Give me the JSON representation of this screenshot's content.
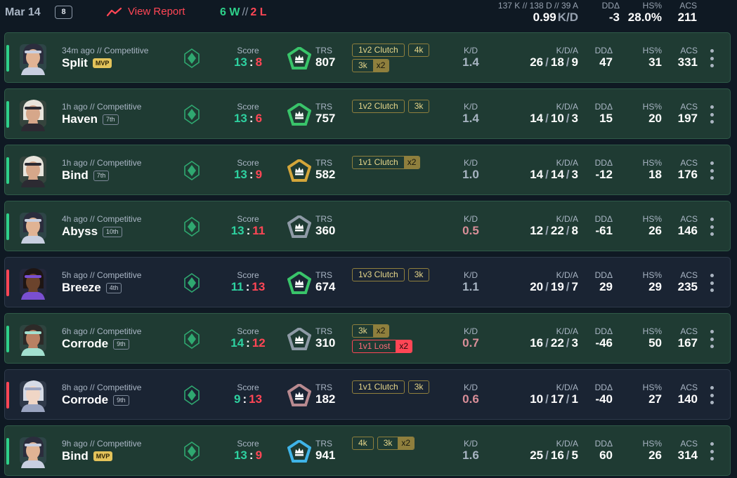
{
  "header": {
    "date": "Mar 14",
    "match_count": "8",
    "view_report_label": "View Report",
    "wins": "6 W",
    "separator": "//",
    "losses": "2 L",
    "kda_raw": "137 K // 138 D // 39 A",
    "kd_value": "0.99",
    "kd_unit": "K/D",
    "stats": [
      {
        "label": "DDΔ",
        "value": "-3"
      },
      {
        "label": "HS%",
        "value": "28.0%"
      },
      {
        "label": "ACS",
        "value": "211"
      }
    ]
  },
  "column_labels": {
    "score": "Score",
    "trs": "TRS",
    "kd": "K/D",
    "kda": "K/D/A",
    "dd": "DDΔ",
    "hs": "HS%",
    "acs": "ACS"
  },
  "matches": [
    {
      "result": "win",
      "agent": "agent-portrait-white-hair",
      "meta": "34m ago // Competitive",
      "map": "Split",
      "badge": {
        "type": "mvp",
        "text": "MVP"
      },
      "rank_color": "#2fa870",
      "score_own": "13",
      "score_opp": "8",
      "trs_color": "#39c46a",
      "trs": "807",
      "tags": [
        [
          {
            "label": "1v2 Clutch"
          },
          {
            "label": "4k"
          }
        ],
        [
          {
            "label": "3k",
            "mult": "x2"
          }
        ]
      ],
      "kd": "1.4",
      "kd_bad": false,
      "kills": "26",
      "deaths": "18",
      "assists": "9",
      "dd": "47",
      "hs": "31",
      "acs": "331"
    },
    {
      "result": "win",
      "agent": "agent-portrait-cowboy-hat",
      "meta": "1h ago // Competitive",
      "map": "Haven",
      "badge": {
        "type": "place",
        "text": "7th"
      },
      "rank_color": "#2fa870",
      "score_own": "13",
      "score_opp": "6",
      "trs_color": "#39c46a",
      "trs": "757",
      "tags": [
        [
          {
            "label": "1v2 Clutch"
          },
          {
            "label": "3k"
          }
        ]
      ],
      "kd": "1.4",
      "kd_bad": false,
      "kills": "14",
      "deaths": "10",
      "assists": "3",
      "dd": "15",
      "hs": "20",
      "acs": "197"
    },
    {
      "result": "win",
      "agent": "agent-portrait-cowboy-hat",
      "meta": "1h ago // Competitive",
      "map": "Bind",
      "badge": {
        "type": "place",
        "text": "7th"
      },
      "rank_color": "#2fa870",
      "score_own": "13",
      "score_opp": "9",
      "trs_color": "#d4a63a",
      "trs": "582",
      "tags": [
        [
          {
            "label": "1v1 Clutch",
            "mult": "x2"
          }
        ]
      ],
      "kd": "1.0",
      "kd_bad": false,
      "kills": "14",
      "deaths": "14",
      "assists": "3",
      "dd": "-12",
      "hs": "18",
      "acs": "176"
    },
    {
      "result": "win",
      "agent": "agent-portrait-white-hair",
      "meta": "4h ago // Competitive",
      "map": "Abyss",
      "badge": {
        "type": "place",
        "text": "10th"
      },
      "rank_color": "#2fa870",
      "score_own": "13",
      "score_opp": "11",
      "trs_color": "#8e9aa6",
      "trs": "360",
      "tags": [],
      "kd": "0.5",
      "kd_bad": true,
      "kills": "12",
      "deaths": "22",
      "assists": "8",
      "dd": "-61",
      "hs": "26",
      "acs": "146"
    },
    {
      "result": "loss",
      "agent": "agent-portrait-dark-skin",
      "meta": "5h ago // Competitive",
      "map": "Breeze",
      "badge": {
        "type": "place",
        "text": "4th"
      },
      "rank_color": "#2fa870",
      "score_own": "11",
      "score_opp": "13",
      "trs_color": "#39c46a",
      "trs": "674",
      "tags": [
        [
          {
            "label": "1v3 Clutch"
          },
          {
            "label": "3k"
          }
        ]
      ],
      "kd": "1.1",
      "kd_bad": false,
      "kills": "20",
      "deaths": "19",
      "assists": "7",
      "dd": "29",
      "hs": "29",
      "acs": "235"
    },
    {
      "result": "win",
      "agent": "agent-portrait-tan-skin",
      "meta": "6h ago // Competitive",
      "map": "Corrode",
      "badge": {
        "type": "place",
        "text": "9th"
      },
      "rank_color": "#2fa870",
      "score_own": "14",
      "score_opp": "12",
      "trs_color": "#8e9aa6",
      "trs": "310",
      "tags": [
        [
          {
            "label": "3k",
            "mult": "x2"
          }
        ],
        [
          {
            "label": "1v1 Lost",
            "mult": "x2",
            "lost": true
          }
        ]
      ],
      "kd": "0.7",
      "kd_bad": true,
      "kills": "16",
      "deaths": "22",
      "assists": "3",
      "dd": "-46",
      "hs": "50",
      "acs": "167"
    },
    {
      "result": "loss",
      "agent": "agent-portrait-silver-hair",
      "meta": "8h ago // Competitive",
      "map": "Corrode",
      "badge": {
        "type": "place",
        "text": "9th"
      },
      "rank_color": "#2fa870",
      "score_own": "9",
      "score_opp": "13",
      "trs_color": "#b88a90",
      "trs": "182",
      "tags": [
        [
          {
            "label": "1v1 Clutch"
          },
          {
            "label": "3k"
          }
        ]
      ],
      "kd": "0.6",
      "kd_bad": true,
      "kills": "10",
      "deaths": "17",
      "assists": "1",
      "dd": "-40",
      "hs": "27",
      "acs": "140"
    },
    {
      "result": "win",
      "agent": "agent-portrait-white-hair",
      "meta": "9h ago // Competitive",
      "map": "Bind",
      "badge": {
        "type": "mvp",
        "text": "MVP"
      },
      "rank_color": "#2fa870",
      "score_own": "13",
      "score_opp": "9",
      "trs_color": "#3fb4e8",
      "trs": "941",
      "tags": [
        [
          {
            "label": "4k"
          },
          {
            "label": "3k",
            "mult": "x2"
          }
        ]
      ],
      "kd": "1.6",
      "kd_bad": false,
      "kills": "25",
      "deaths": "16",
      "assists": "5",
      "dd": "60",
      "hs": "26",
      "acs": "314"
    }
  ],
  "colors": {
    "win": "#2ed18a",
    "loss": "#ff4655",
    "tag_gold": "#8f7f3d"
  },
  "agent_portraits": {
    "agent-portrait-white-hair": {
      "skin": "#e0b394",
      "hair": "#2b2d3d",
      "band": "#c8cfe0",
      "bg": "#4a5a6e"
    },
    "agent-portrait-cowboy-hat": {
      "skin": "#d6a78a",
      "hair": "#e8e4dc",
      "band": "#2c2a32",
      "bg": "#5e5550"
    },
    "agent-portrait-dark-skin": {
      "skin": "#6b432c",
      "hair": "#1e1513",
      "band": "#7a4fd1",
      "bg": "#3a2f4a"
    },
    "agent-portrait-tan-skin": {
      "skin": "#b98163",
      "hair": "#2d2a28",
      "band": "#a2e0cf",
      "bg": "#4a5556"
    },
    "agent-portrait-silver-hair": {
      "skin": "#f0d6c6",
      "hair": "#d6dbe6",
      "band": "#9aa4c0",
      "bg": "#5a6072"
    }
  }
}
